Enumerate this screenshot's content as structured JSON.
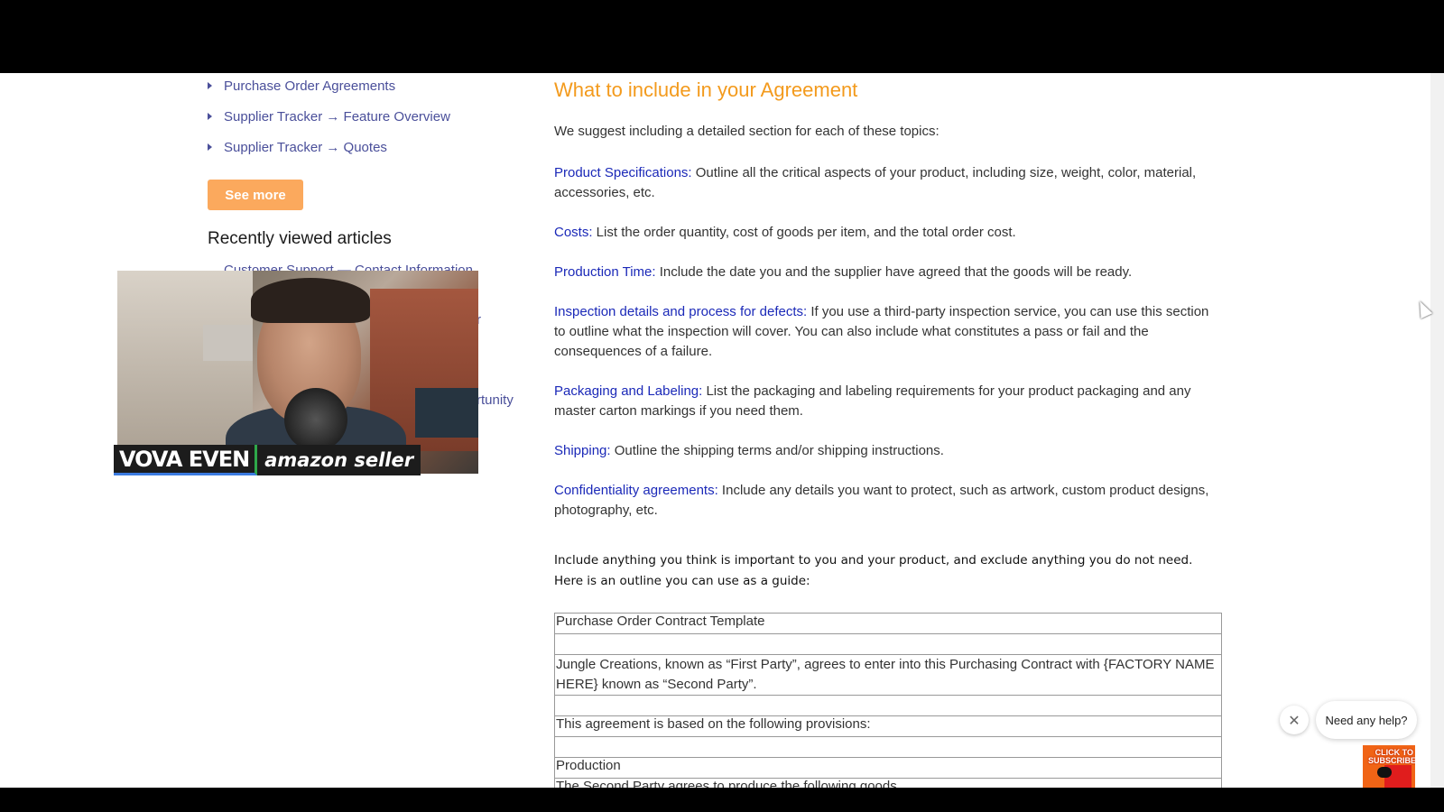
{
  "sidebar": {
    "links": [
      "Purchase Order Agreements",
      "Supplier Tracker → Feature Overview",
      "Supplier Tracker → Quotes"
    ],
    "see_more_label": "See more",
    "recently_viewed_title": "Recently viewed articles",
    "recent_links": [
      "Customer Support — Contact Information",
      "r",
      "rtunity"
    ]
  },
  "webcam": {
    "name": "VOVA EVEN",
    "role": "amazon seller"
  },
  "article": {
    "heading": "What to include in your Agreement",
    "intro": "We suggest including a detailed section for each of these topics:",
    "topics": [
      {
        "term": "Product Specifications:",
        "text": " Outline all the critical aspects of your product, including size, weight, color, material, accessories, etc."
      },
      {
        "term": "Costs:",
        "text": " List the order quantity, cost of goods per item, and the total order cost."
      },
      {
        "term": "Production Time:",
        "text": " Include the date you and the supplier have agreed that the goods will be ready."
      },
      {
        "term": "Inspection details and process for defects:",
        "text": " If you use a third-party inspection service, you can use this section to outline what the inspection will cover. You can also include what constitutes a pass or fail and the consequences of a failure."
      },
      {
        "term": "Packaging and Labeling:",
        "text": " List the packaging and labeling requirements for your product packaging and any master carton markings if you need them."
      },
      {
        "term": "Shipping:",
        "text": " Outline the shipping terms and/or shipping instructions."
      },
      {
        "term": "Confidentiality agreements:",
        "text": " Include any details you want to protect, such as artwork, custom product designs, photography, etc."
      }
    ],
    "note": "Include anything you think is important to you and your product, and exclude anything you do not need. Here is an outline you can use as a guide:",
    "table_rows": [
      "Purchase Order Contract Template",
      "",
      "Jungle Creations, known as “First Party”, agrees to enter into this Purchasing Contract with {FACTORY NAME HERE} known as “Second Party”.",
      "",
      "This agreement is based on the following provisions:",
      "",
      "Production",
      "The Second Party agrees to produce the following goods"
    ]
  },
  "chat": {
    "close_icon": "✕",
    "prompt": "Need any help?"
  },
  "subscribe": {
    "label": "CLICK TO SUBSCRIBE"
  }
}
